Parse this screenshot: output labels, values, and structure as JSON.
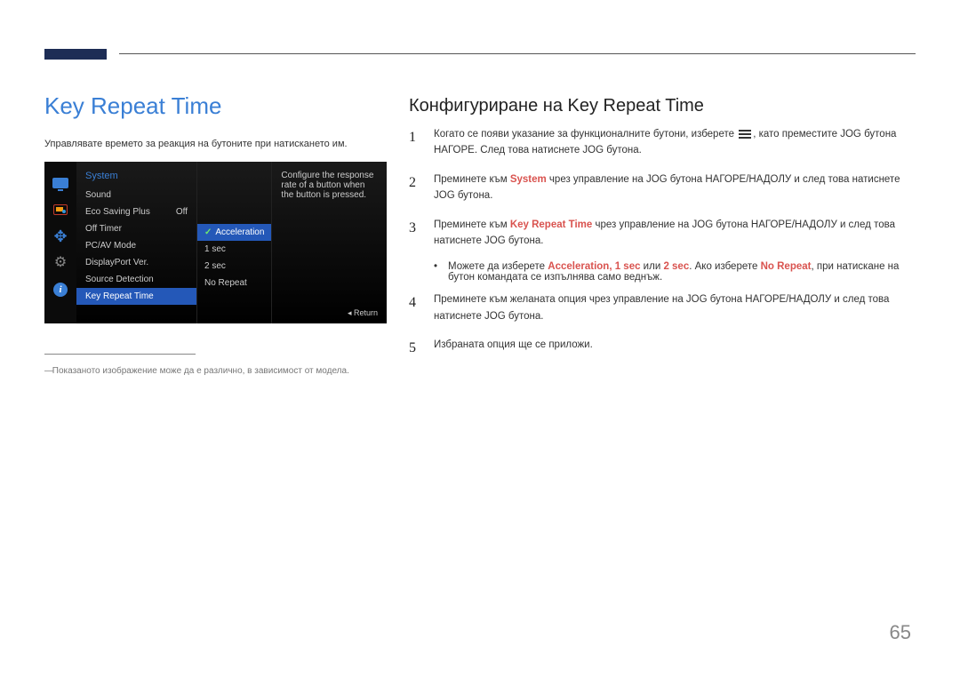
{
  "page_title": "Key Repeat Time",
  "intro": "Управлявате времето за реакция на бутоните при натискането им.",
  "osd": {
    "header": "System",
    "menu": [
      {
        "label": "Sound",
        "value": ""
      },
      {
        "label": "Eco Saving Plus",
        "value": "Off"
      },
      {
        "label": "Off Timer",
        "value": ""
      },
      {
        "label": "PC/AV Mode",
        "value": ""
      },
      {
        "label": "DisplayPort Ver.",
        "value": ""
      },
      {
        "label": "Source Detection",
        "value": ""
      },
      {
        "label": "Key Repeat Time",
        "value": "",
        "selected": true
      }
    ],
    "submenu": [
      {
        "label": "Acceleration",
        "selected": true
      },
      {
        "label": "1 sec"
      },
      {
        "label": "2 sec"
      },
      {
        "label": "No Repeat"
      }
    ],
    "desc": "Configure the response rate of a button when the button is pressed.",
    "return_label": "Return",
    "icons": [
      "monitor",
      "picture",
      "move",
      "gear",
      "info"
    ]
  },
  "footnote": "Показаното изображение може да е различно, в зависимост от модела.",
  "right_title": "Конфигуриране на Key Repeat Time",
  "steps": {
    "s1a": "Когато се появи указание за функционалните бутони, изберете ",
    "s1b": ", като преместите JOG бутона НАГОРЕ. След това натиснете JOG бутона.",
    "s2a": "Преминете към ",
    "s2_system": "System",
    "s2b": " чрез управление на JOG бутона НАГОРЕ/НАДОЛУ и след това натиснете JOG бутона.",
    "s3a": "Преминете към ",
    "s3_krt": "Key Repeat Time",
    "s3b": " чрез управление на JOG бутона НАГОРЕ/НАДОЛУ и след това натиснете JOG бутона.",
    "bullet_a": "Можете да изберете ",
    "bullet_acc": "Acceleration",
    "bullet_comma": ", ",
    "bullet_1s": "1 sec",
    "bullet_or": " или ",
    "bullet_2s": "2 sec",
    "bullet_b1": ". Ако изберете ",
    "bullet_nr": "No Repeat",
    "bullet_b2": ", при натискане на бутон командата се изпълнява само веднъж.",
    "s4": "Преминете към желаната опция чрез управление на JOG бутона НАГОРЕ/НАДОЛУ и след това натиснете JOG бутона.",
    "s5": "Избраната опция ще се приложи."
  },
  "page_number": "65"
}
